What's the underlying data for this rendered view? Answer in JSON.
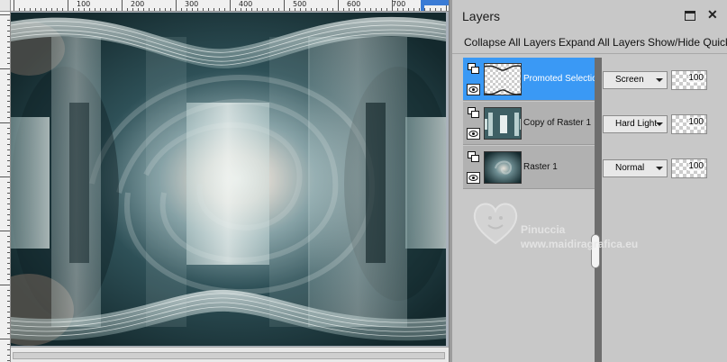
{
  "ruler": {
    "labels": [
      "100",
      "200",
      "300",
      "400",
      "500",
      "600",
      "700"
    ]
  },
  "panel": {
    "title": "Layers",
    "toolbar": {
      "collapse_all": "Collapse All Layers",
      "expand_all": "Expand All Layers",
      "show_hide": "Show/Hide Quick"
    }
  },
  "layers": [
    {
      "name": "Promoted Selection",
      "blend_mode": "Screen",
      "opacity": "100",
      "selected": true
    },
    {
      "name": "Copy of Raster 1",
      "blend_mode": "Hard Light",
      "opacity": "100",
      "selected": false
    },
    {
      "name": "Raster 1",
      "blend_mode": "Normal",
      "opacity": "100",
      "selected": false
    }
  ],
  "watermark": {
    "name": "Pinuccia",
    "site": "www.maidiragrafica.eu"
  },
  "icons": {
    "panel_menu": "window-icon",
    "close": "close-icon",
    "group": "layer-group-icon",
    "visibility": "eye-icon"
  },
  "colors": {
    "selected_row": "#3a99f5",
    "canvas_teal": "#2b4a50",
    "panel_bg": "#c8c8c8"
  }
}
